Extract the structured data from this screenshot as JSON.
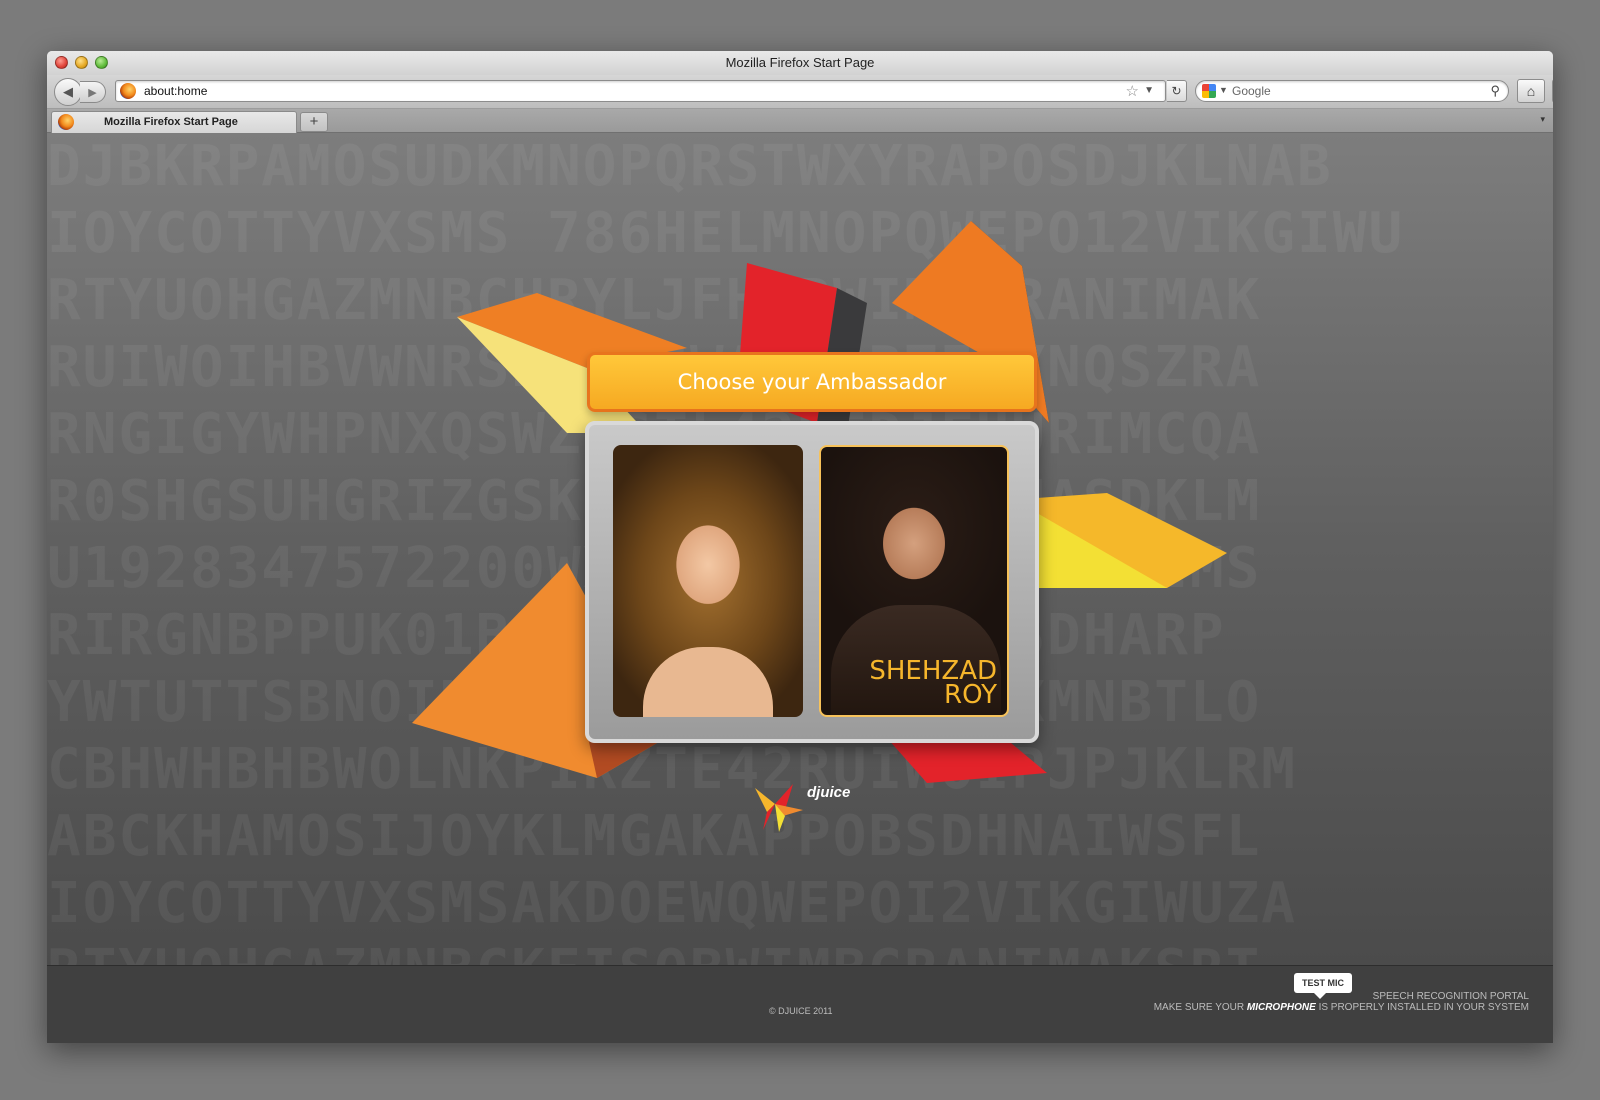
{
  "window": {
    "title": "Mozilla Firefox Start Page"
  },
  "navbar": {
    "url": "about:home",
    "search_placeholder": "Google"
  },
  "tabs": [
    {
      "label": "Mozilla Firefox Start Page",
      "active": true
    }
  ],
  "icons": {
    "back": "back-arrow-icon",
    "forward": "forward-arrow-icon",
    "bookmark_star": "star-icon",
    "reload": "reload-icon",
    "search": "magnifier-icon",
    "home": "home-icon",
    "bookmarks": "bookmarks-icon",
    "new_tab": "plus-icon"
  },
  "page": {
    "banner_title": "Choose your Ambassador",
    "ambassadors": [
      {
        "name": ""
      },
      {
        "name_line1": "SHEHZAD",
        "name_line2": "ROY"
      }
    ],
    "logo_text": "djuice",
    "footer": {
      "copyright": "© DJUICE 2011",
      "test_mic_label": "TEST MIC",
      "portal_title": "SPEECH RECOGNITION PORTAL",
      "mic_note_prefix": "MAKE SURE YOUR",
      "mic_note_emphasis": "MICROPHONE",
      "mic_note_suffix": "IS PROPERLY INSTALLED IN YOUR SYSTEM"
    }
  },
  "colors": {
    "banner": "#f6a922",
    "banner_border": "#e8741d",
    "name_accent": "#f6b62c",
    "shape_orange": "#ef7a1e",
    "shape_red": "#e3232a",
    "shape_yellow": "#fcd84a"
  }
}
